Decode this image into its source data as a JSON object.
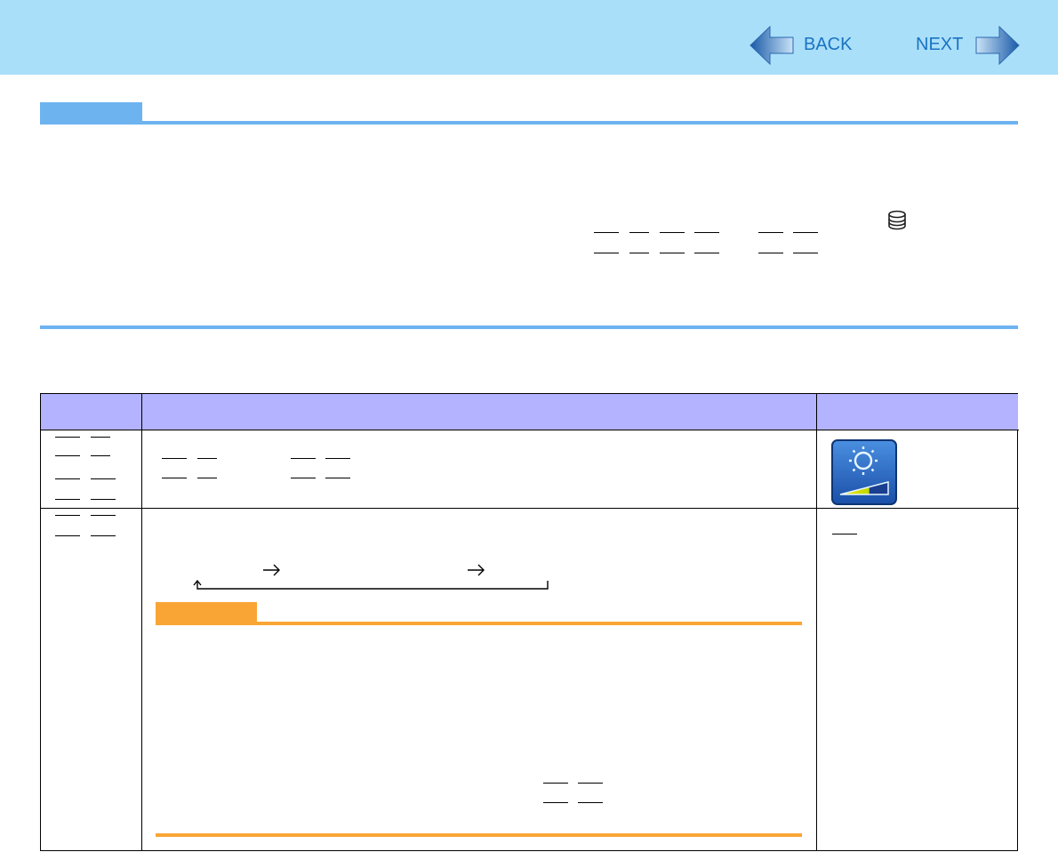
{
  "nav": {
    "back_label": "BACK",
    "next_label": "NEXT"
  },
  "colors": {
    "header_bg": "#aadff9",
    "section_rule": "#6cb3f0",
    "table_header": "#b3b3ff",
    "caution_rule": "#f9a535",
    "nav_text": "#1a73c2"
  },
  "icons": {
    "back": "back-arrow-icon",
    "next": "next-arrow-icon",
    "hdd": "hard-disk-icon",
    "brightness": "brightness-icon"
  }
}
